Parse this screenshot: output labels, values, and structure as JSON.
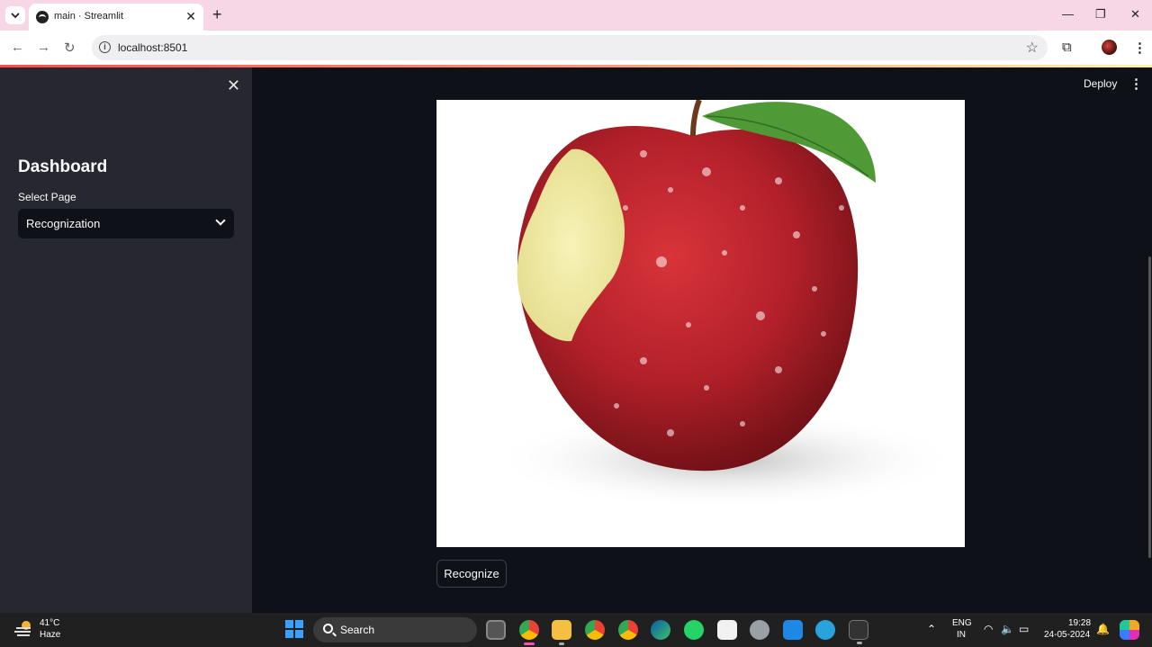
{
  "browser": {
    "tab_title": "main · Streamlit",
    "url": "localhost:8501"
  },
  "sidebar": {
    "title": "Dashboard",
    "select_label": "Select Page",
    "select_value": "Recognization"
  },
  "header": {
    "deploy_label": "Deploy"
  },
  "main": {
    "image_description": "bitten red apple with leaf",
    "recognize_label": "Recognize"
  },
  "taskbar": {
    "weather_temp": "41°C",
    "weather_desc": "Haze",
    "search_placeholder": "Search",
    "lang_line1": "ENG",
    "lang_line2": "IN",
    "time": "19:28",
    "date": "24-05-2024"
  },
  "colors": {
    "app_bg": "#0e1117",
    "sidebar_bg": "#262730",
    "tabbar_bg": "#f7d7e5",
    "accent": "#ff4b4b"
  }
}
